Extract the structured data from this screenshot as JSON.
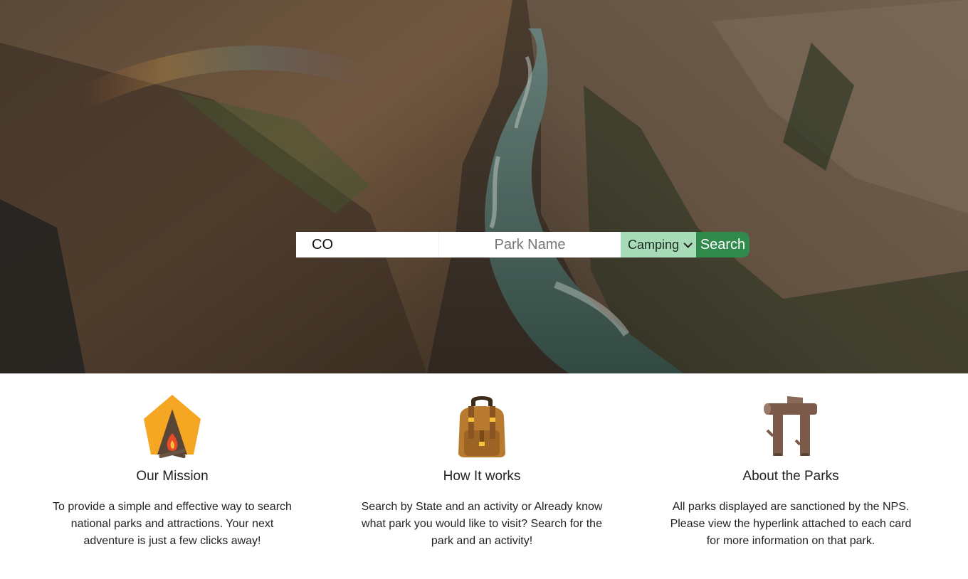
{
  "search": {
    "state_value": "CO",
    "park_placeholder": "Park Name",
    "activity_selected": "Camping",
    "button_label": "Search"
  },
  "features": [
    {
      "icon": "tent-campfire-icon",
      "title": "Our Mission",
      "text": "To provide a simple and effective way to search national parks and attractions. Your next adventure is just a few clicks away!"
    },
    {
      "icon": "backpack-icon",
      "title": "How It works",
      "text": "Search by State and an activity or Already know what park you would like to visit? Search for the park and an activity!"
    },
    {
      "icon": "log-gate-icon",
      "title": "About the Parks",
      "text": "All parks displayed are sanctioned by the NPS. Please view the hyperlink attached to each card for more information on that park."
    }
  ],
  "colors": {
    "select_bg": "#a8dcb8",
    "button_bg": "#2f8a4c"
  }
}
